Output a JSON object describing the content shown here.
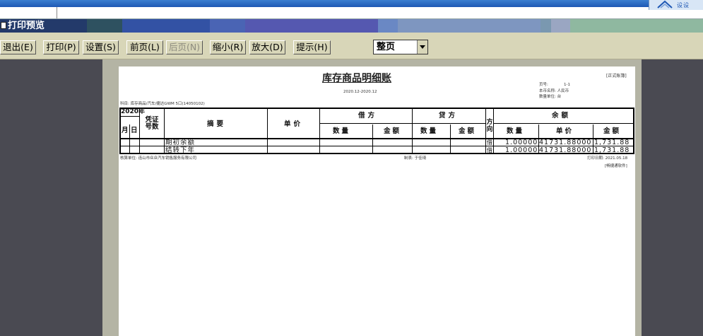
{
  "app": {
    "logo_text": "设设",
    "window_title": "打印预览",
    "titlebar_colors": [
      "#233a6a",
      "#2e5160",
      "#3352a4",
      "#4a64b4",
      "#5558b0",
      "#6a88c4",
      "#7e96c0",
      "#7a98b0",
      "#9aa6c2",
      "#8fb8a0",
      "#a8c4f0"
    ]
  },
  "toolbar": {
    "exit_label": "退出(E)",
    "print_label": "打印(P)",
    "setup_label": "设置(S)",
    "prev_label": "前页(L)",
    "next_label": "后页(N)",
    "zoom_out_label": "缩小(R)",
    "zoom_in_label": "放大(D)",
    "hint_label": "提示(H)",
    "page_mode_value": "整页"
  },
  "report": {
    "title": "库存商品明细账",
    "badge": "[正式账簿]",
    "date_range": "2020.12-2020.12",
    "page_no_label": "页号:",
    "page_no": "1-1",
    "currency_line": "本币名称: 人民币",
    "unit_line": "数量单位: 台",
    "account_line": "科目: 库存商品/汽车/捷达GWM 5口(14050102)",
    "headers": {
      "year": "2020年",
      "month": "月",
      "day": "日",
      "voucher_no": "凭证号数",
      "summary": "摘要",
      "unit_price": "单价",
      "debit": "借方",
      "credit": "贷方",
      "direction": "方向",
      "balance": "余额",
      "qty": "数量",
      "amount": "金额",
      "bal_qty": "数量",
      "bal_price": "单价",
      "bal_amount": "金额"
    },
    "rows": [
      {
        "summary": "期初余额",
        "direction": "借",
        "qty": "1.00000",
        "price": "41731.88000",
        "amount": "1,731.88"
      },
      {
        "summary": "结转下年",
        "direction": "借",
        "qty": "1.00000",
        "price": "41731.88000",
        "amount": "1,731.88"
      }
    ],
    "footer_company": "核算单位: 连山市众众汽车销售服务有限公司",
    "footer_maker": "制表: 于佳琦",
    "footer_print_date": "打印日期: 2021.05.18",
    "footer_software": "[畅捷通软件]"
  }
}
